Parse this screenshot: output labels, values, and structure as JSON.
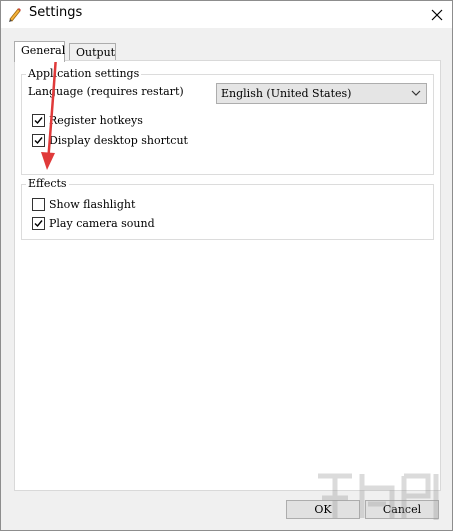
{
  "window": {
    "title": "Settings"
  },
  "tabs": [
    {
      "label": "General",
      "active": true
    },
    {
      "label": "Output",
      "active": false
    }
  ],
  "app_settings": {
    "title": "Application settings",
    "language_label": "Language (requires restart)",
    "language_value": "English (United States)",
    "checkboxes": [
      {
        "label": "Register hotkeys",
        "checked": true
      },
      {
        "label": "Display desktop shortcut",
        "checked": true
      }
    ]
  },
  "effects": {
    "title": "Effects",
    "checkboxes": [
      {
        "label": "Show flashlight",
        "checked": false
      },
      {
        "label": "Play camera sound",
        "checked": true
      }
    ]
  },
  "buttons": {
    "ok": "OK",
    "cancel": "Cancel"
  },
  "colors": {
    "arrow": "#e03a3a"
  }
}
